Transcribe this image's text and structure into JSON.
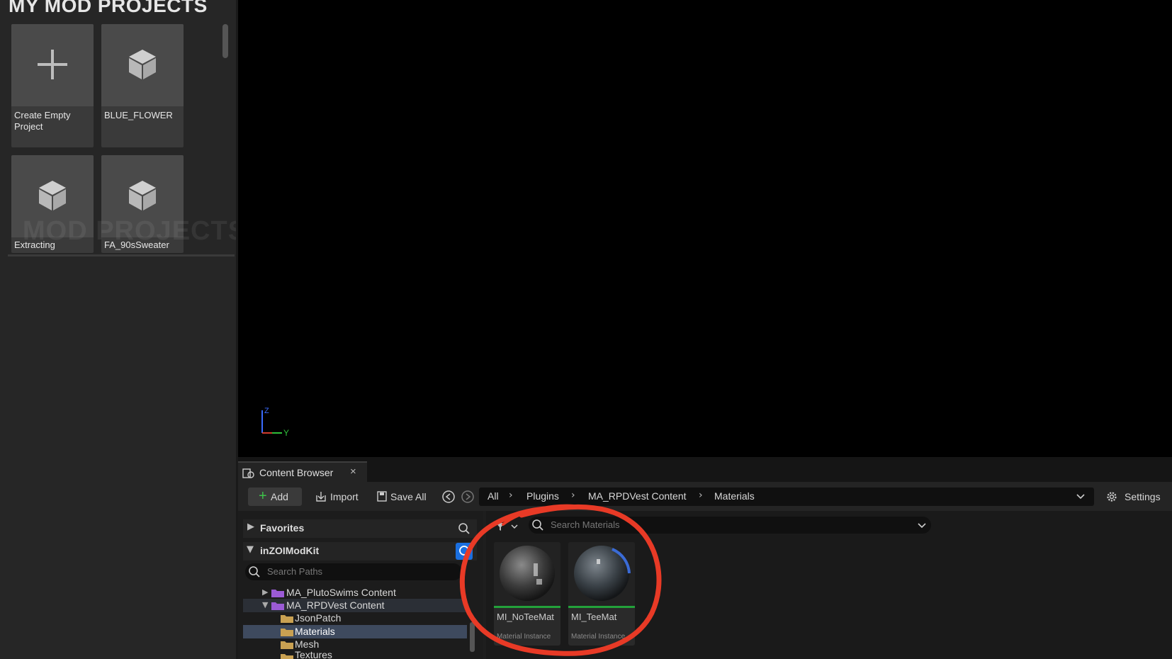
{
  "left_panel": {
    "title": "MY MOD PROJECTS",
    "watermark": "MOD PROJECTS",
    "tiles": [
      {
        "label": "Create Empty Project",
        "icon": "plus-icon"
      },
      {
        "label": "BLUE_FLOWER",
        "icon": "cube-icon"
      },
      {
        "label": "Extracting",
        "icon": "cube-icon"
      },
      {
        "label": "FA_90sSweater",
        "icon": "cube-icon"
      }
    ]
  },
  "viewport": {
    "axis_z": "Z",
    "axis_y": "Y"
  },
  "content_browser": {
    "tab_label": "Content Browser",
    "toolbar": {
      "add_label": "Add",
      "import_label": "Import",
      "save_all_label": "Save All",
      "settings_label": "Settings"
    },
    "breadcrumb": [
      "All",
      "Plugins",
      "MA_RPDVest Content",
      "Materials"
    ],
    "sources": {
      "favorites_label": "Favorites",
      "root_label": "inZOIModKit",
      "search_placeholder": "Search Paths",
      "items": [
        {
          "label": "MA_PlutoSwims Content"
        },
        {
          "label": "MA_RPDVest Content"
        },
        {
          "label": "JsonPatch"
        },
        {
          "label": "Materials",
          "selected": true
        },
        {
          "label": "Mesh"
        },
        {
          "label": "Textures"
        }
      ]
    },
    "search_materials_placeholder": "Search Materials",
    "assets": [
      {
        "name": "MI_NoTeeMat",
        "type": "Material Instance"
      },
      {
        "name": "MI_TeeMat",
        "type": "Material Instance"
      }
    ]
  },
  "colors": {
    "accent_blue": "#1a6fe0",
    "asset_green": "#23a13a",
    "annotation_red": "#e83a26"
  }
}
